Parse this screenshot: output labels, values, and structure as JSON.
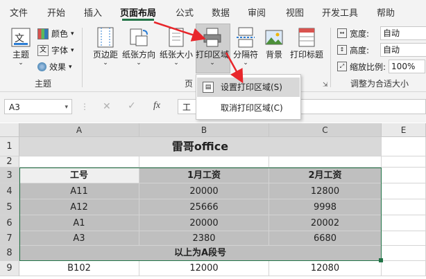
{
  "ribbon_tabs": [
    "文件",
    "开始",
    "插入",
    "页面布局",
    "公式",
    "数据",
    "审阅",
    "视图",
    "开发工具",
    "帮助"
  ],
  "active_tab": "页面布局",
  "themes": {
    "theme_label": "主题",
    "colors_label": "颜色",
    "fonts_label": "字体",
    "effects_label": "效果",
    "group_label": "主题"
  },
  "page_setup": {
    "margins_label": "页边距",
    "orientation_label": "纸张方向",
    "size_label": "纸张大小",
    "print_area_label": "打印区域",
    "breaks_label": "分隔符",
    "background_label": "背景",
    "print_titles_label": "打印标题",
    "group_label": "页"
  },
  "scale_to_fit": {
    "width_label": "宽度:",
    "width_value": "自动",
    "height_label": "高度:",
    "height_value": "自动",
    "scale_label": "缩放比例:",
    "scale_value": "100%",
    "group_label": "调整为合适大小"
  },
  "print_area_menu": {
    "set_label": "设置打印区域(S)",
    "clear_label": "取消打印区域(C)"
  },
  "formula_bar": {
    "name_box": "A3",
    "fx": "fx",
    "content": "工"
  },
  "sheet": {
    "columns": [
      "A",
      "B",
      "C",
      "E"
    ],
    "rows": [
      "1",
      "2",
      "3",
      "4",
      "5",
      "6",
      "7",
      "8",
      "9"
    ],
    "title": "雷哥office",
    "headers": [
      "工号",
      "1月工资",
      "2月工资"
    ],
    "data": [
      [
        "A11",
        "20000",
        "12800"
      ],
      [
        "A12",
        "25666",
        "9998"
      ],
      [
        "A1",
        "20000",
        "20002"
      ],
      [
        "A3",
        "2380",
        "6680"
      ]
    ],
    "note": "以上为A段号",
    "last_row": [
      "B102",
      "12000",
      "12080"
    ]
  },
  "colors": {
    "accent": "#217346",
    "arrow": "#e8262b",
    "selected_fill": "#bfbfbf",
    "title_fill": "#d9d9d9"
  }
}
